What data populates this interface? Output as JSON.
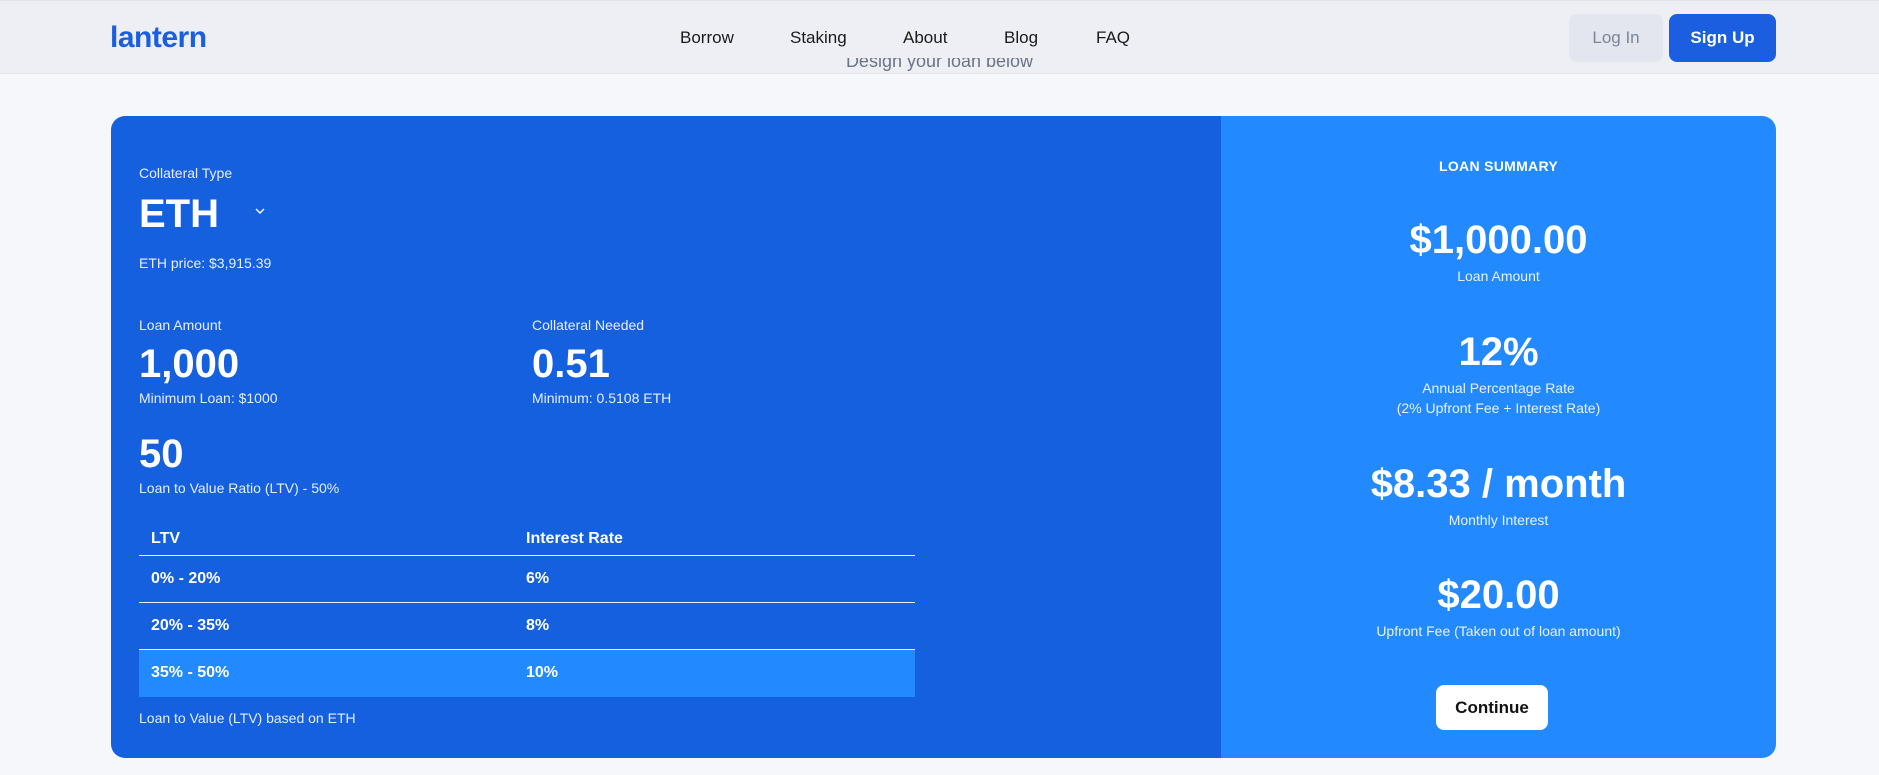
{
  "nav": {
    "logo": "lantern",
    "links": [
      "Borrow",
      "Staking",
      "About",
      "Blog",
      "FAQ"
    ],
    "login_label": "Log In",
    "signup_label": "Sign Up"
  },
  "page": {
    "subtitle": "Design your loan below"
  },
  "form": {
    "collateral_type_label": "Collateral Type",
    "collateral_type_value": "ETH",
    "eth_price": "ETH price: $3,915.39",
    "loan_amount_label": "Loan Amount",
    "loan_amount_value": "1,000",
    "loan_min": "Minimum Loan: $1000",
    "collateral_needed_label": "Collateral Needed",
    "collateral_needed_value": "0.51",
    "collateral_min": "Minimum: 0.5108 ETH",
    "ltv_value": "50",
    "ltv_label": "Loan to Value Ratio (LTV) - 50%",
    "ltv_table": {
      "headers": [
        "LTV",
        "Interest Rate"
      ],
      "rows": [
        [
          "0% - 20%",
          "6%"
        ],
        [
          "20% - 35%",
          "8%"
        ],
        [
          "35% - 50%",
          "10%"
        ]
      ],
      "active_row": 2
    },
    "ltv_footnote": "Loan to Value (LTV) based on ETH"
  },
  "summary": {
    "title": "LOAN SUMMARY",
    "loan_amount_value": "$1,000.00",
    "loan_amount_label": "Loan Amount",
    "apr_value": "12%",
    "apr_label": "Annual Percentage Rate",
    "apr_note": "(2% Upfront Fee + Interest Rate)",
    "monthly_value": "$8.33 / month",
    "monthly_label": "Monthly Interest",
    "upfront_value": "$20.00",
    "upfront_label": "Upfront Fee (Taken out of loan amount)",
    "continue_label": "Continue"
  },
  "colors": {
    "brand": "#1b5fe0",
    "left_panel": "#1560df",
    "right_panel": "#2389ff"
  },
  "icons": {
    "collateral_dropdown": "chevron-down-icon"
  }
}
